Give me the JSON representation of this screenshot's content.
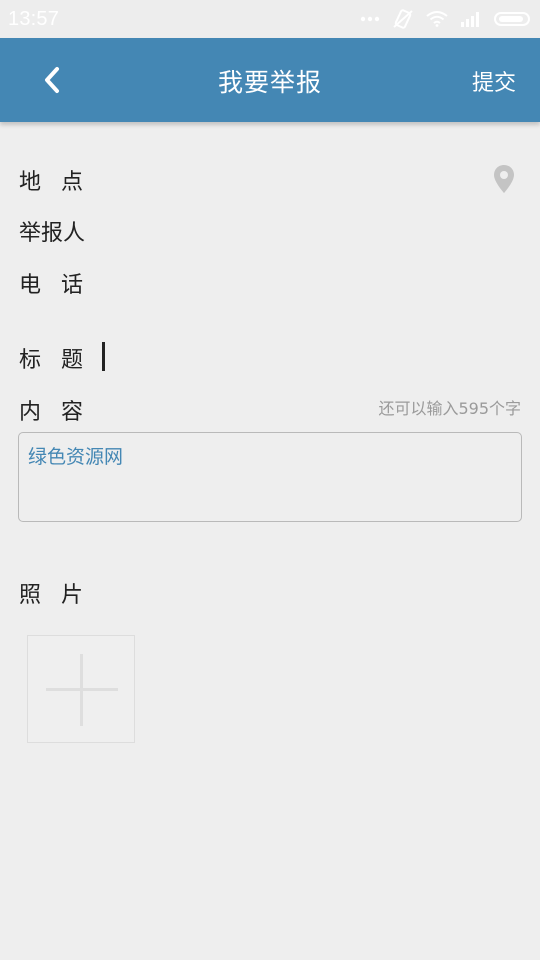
{
  "status_bar": {
    "time": "13:57"
  },
  "header": {
    "title": "我要举报",
    "submit_label": "提交",
    "background_color": "#4487b4"
  },
  "form": {
    "location_label": "地点",
    "reporter_label": "举报人",
    "phone_label": "电话",
    "title_label": "标题",
    "content_label": "内容",
    "remaining_hint": "还可以输入595个字",
    "content_text": "绿色资源网",
    "photo_label": "照片"
  },
  "icons": [
    "back-arrow-icon",
    "location-pin-icon",
    "plus-icon",
    "wifi-icon",
    "signal-icon",
    "battery-icon"
  ]
}
